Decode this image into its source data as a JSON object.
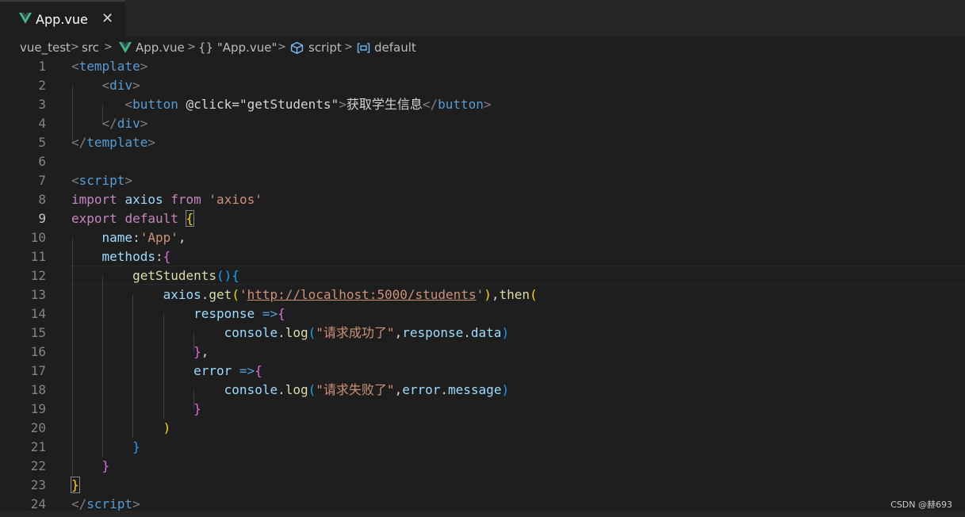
{
  "tab": {
    "label": "App.vue",
    "close": "✕"
  },
  "breadcrumb": {
    "items": [
      "vue_test",
      "src",
      "App.vue",
      "{} \"App.vue\"",
      "script",
      "default"
    ],
    "separator": ">"
  },
  "editor": {
    "active_line": 9,
    "line_numbers": [
      "1",
      "2",
      "3",
      "4",
      "5",
      "6",
      "7",
      "8",
      "9",
      "10",
      "11",
      "12",
      "13",
      "14",
      "15",
      "16",
      "17",
      "18",
      "19",
      "20",
      "21",
      "22",
      "23",
      "24"
    ],
    "lines": {
      "l1_open": "<",
      "l1_name": "template",
      "l1_close": ">",
      "l2_open": "<",
      "l2_name": "div",
      "l2_close": ">",
      "l3_open": "<",
      "l3_name": "button",
      "l3_attr": "@click",
      "l3_eq": "=",
      "l3_val": "\"getStudents\"",
      "l3_gt": ">",
      "l3_text": "获取学生信息",
      "l3_endopen": "</",
      "l3_endname": "button",
      "l3_endclose": ">",
      "l4_open": "</",
      "l4_name": "div",
      "l4_close": ">",
      "l5_open": "</",
      "l5_name": "template",
      "l5_close": ">",
      "l7_open": "<",
      "l7_name": "script",
      "l7_close": ">",
      "l8_import": "import",
      "l8_axios": "axios",
      "l8_from": "from",
      "l8_str": "'axios'",
      "l9_export": "export",
      "l9_default": "default",
      "l9_brace": "{",
      "l10_name": "name",
      "l10_colon": ":",
      "l10_str": "'App'",
      "l10_comma": ",",
      "l11_methods": "methods",
      "l11_colon": ":",
      "l11_brace": "{",
      "l12_fn": "getStudents",
      "l12_paren": "()",
      "l12_brace": "{",
      "l13_axios": "axios",
      "l13_dot": ".",
      "l13_get": "get",
      "l13_paren": "(",
      "l13_q1": "'",
      "l13_url": "http://localhost:5000/students",
      "l13_q2": "'",
      "l13_close": ")",
      "l13_comma": ",",
      "l13_then": "then",
      "l13_open": "(",
      "l14_param": "response",
      "l14_arrow": " =>",
      "l14_brace": "{",
      "l15_console": "console",
      "l15_dot": ".",
      "l15_log": "log",
      "l15_open": "(",
      "l15_str": "\"请求成功了\"",
      "l15_comma": ",",
      "l15_resp": "response",
      "l15_dot2": ".",
      "l15_data": "data",
      "l15_close": ")",
      "l16_brace": "}",
      "l16_comma": ",",
      "l17_param": "error",
      "l17_arrow": " =>",
      "l17_brace": "{",
      "l18_console": "console",
      "l18_dot": ".",
      "l18_log": "log",
      "l18_open": "(",
      "l18_str": "\"请求失败了\"",
      "l18_comma": ",",
      "l18_err": "error",
      "l18_dot2": ".",
      "l18_msg": "message",
      "l18_close": ")",
      "l19_brace": "}",
      "l20_paren": ")",
      "l21_brace": "}",
      "l22_brace": "}",
      "l23_brace": "}",
      "l24_open": "</",
      "l24_name": "script",
      "l24_close": ">"
    }
  },
  "watermark": "CSDN @赫693",
  "colors": {
    "background": "#1e1e1e",
    "tag_name": "#569cd6",
    "keyword": "#c586c0",
    "string": "#ce9178",
    "variable": "#9cdcfe",
    "function": "#dcdcaa",
    "vue_green": "#41b883"
  }
}
